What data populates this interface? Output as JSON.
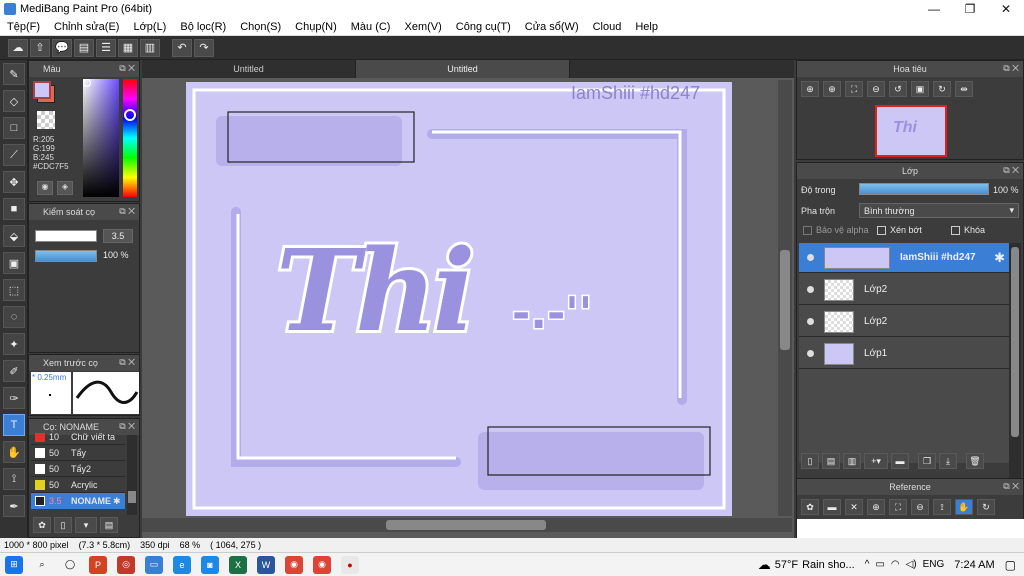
{
  "window": {
    "title": "MediBang Paint Pro (64bit)",
    "minimize": "—",
    "maximize": "❐",
    "close": "✕"
  },
  "menu": [
    "Tệp(F)",
    "Chỉnh sửa(E)",
    "Lớp(L)",
    "Bộ lọc(R)",
    "Chọn(S)",
    "Chụp(N)",
    "Màu (C)",
    "Xem(V)",
    "Công cụ(T)",
    "Cửa sổ(W)",
    "Cloud",
    "Help"
  ],
  "tabs": [
    "Untitled",
    "Untitled"
  ],
  "color_panel": {
    "title": "Màu",
    "primary": "#CDC7F5",
    "secondary": "#D96B55",
    "r": "R:205",
    "g": "G:199",
    "b": "B:245",
    "hex": "#CDC7F5"
  },
  "brush_control": {
    "title": "Kiểm soát cọ",
    "size": "3.5",
    "opacity": "100 %",
    "opacity_value": 1.0
  },
  "brush_preview": {
    "title": "Xem trước cọ",
    "size_label": "* 0.25mm"
  },
  "brush_list": {
    "title": "Cọ: NONAME",
    "items": [
      {
        "size": "10",
        "name": "Chữ viết ta",
        "color": "#e03030"
      },
      {
        "size": "50",
        "name": "Tẩy",
        "color": "#ffffff"
      },
      {
        "size": "50",
        "name": "Tẩy2",
        "color": "#ffffff"
      },
      {
        "size": "50",
        "name": "Acrylic",
        "color": "#e0d020"
      },
      {
        "size": "3.5",
        "name": "NONAME",
        "color": "#222222"
      }
    ]
  },
  "canvas": {
    "background": "#CDC7F5",
    "watermark": "IamShiii #hd247",
    "lettering": "Thi",
    "lettering_tail": "-.-''"
  },
  "navigator": {
    "title": "Hoa tiêu"
  },
  "layers_panel": {
    "title": "Lớp",
    "opacity_label": "Độ trong",
    "opacity_value": "100 %",
    "opacity_fraction": 1.0,
    "blend_label": "Pha trộn",
    "blend_value": "Bình thường",
    "protect_alpha": "Bảo vệ alpha",
    "clipping": "Xén bớt",
    "lock": "Khóa",
    "layers": [
      {
        "name": "IamShiii #hd247",
        "selected": true
      },
      {
        "name": "Lớp2",
        "selected": false
      },
      {
        "name": "Lớp2",
        "selected": false
      },
      {
        "name": "Lớp1",
        "selected": false
      }
    ]
  },
  "reference": {
    "title": "Reference"
  },
  "status": {
    "size": "1000 * 800 pixel",
    "cm": "(7.3 * 5.8cm)",
    "dpi": "350 dpi",
    "zoom": "68 %",
    "coord": "( 1064, 275 )"
  },
  "taskbar": {
    "weather_temp": "57°F",
    "weather_text": "Rain sho...",
    "lang": "ENG",
    "time": "7:24 AM"
  },
  "colors": {
    "accent": "#3A7FD5",
    "panel": "#3C3C3C",
    "canvas_bg": "#CDC7F5",
    "lettering": "#9A92DE"
  }
}
